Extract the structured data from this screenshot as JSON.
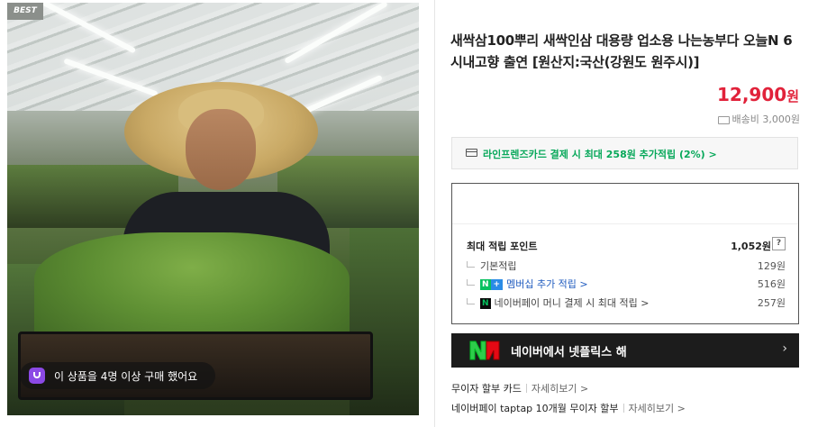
{
  "badge": "BEST",
  "buyer_notice": "이 상품을 4명 이상 구매 했어요",
  "product": {
    "title": "새싹삼100뿌리 새싹인삼 대용량 업소용 나는농부다 오늘N 6시내고향 출연 [원산지:국산(강원도 원주시)]",
    "price": "12,900",
    "currency": "원",
    "shipping": "배송비 3,000원"
  },
  "card_promo": "라인프렌즈카드 결제 시 최대 258원 추가적립 (2%) >",
  "points": {
    "header_label": "최대 적립 포인트",
    "header_value": "1,052원",
    "help": "?",
    "rows": [
      {
        "label": "기본적립",
        "value": "129원"
      },
      {
        "badge": "N",
        "badge2": "+",
        "label": "멤버십 추가 적립 >",
        "value": "516원"
      },
      {
        "badge": "N",
        "label": "네이버페이 머니 결제 시 최대 적립 >",
        "value": "257원"
      }
    ]
  },
  "netflix": {
    "text": "네이버에서 넷플릭스 해",
    "arrow": "›"
  },
  "installments": [
    {
      "label": "무이자 할부 카드",
      "link": "자세히보기 >"
    },
    {
      "label": "네이버페이 taptap 10개월 무이자 할부",
      "link": "자세히보기 >"
    }
  ],
  "colors": {
    "price": "#e1223a",
    "promo": "#07a85a",
    "naver": "#07c15f",
    "link": "#1f5bbf"
  }
}
